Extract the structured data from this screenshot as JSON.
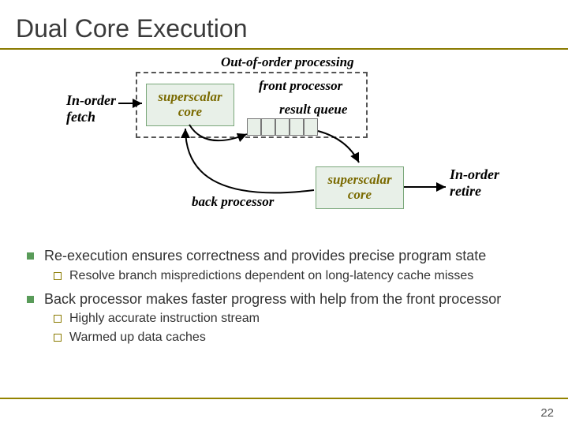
{
  "title": "Dual Core Execution",
  "diagram": {
    "labels": {
      "in_order_fetch_l1": "In-order",
      "in_order_fetch_l2": "fetch",
      "out_of_order": "Out-of-order  processing",
      "front_processor": "front processor",
      "result_queue": "result queue",
      "back_processor": "back processor",
      "in_order_retire_l1": "In-order",
      "in_order_retire_l2": "retire"
    },
    "boxes": {
      "superscalar_core_front": "superscalar\ncore",
      "superscalar_core_back": "superscalar\ncore"
    }
  },
  "bullets": [
    {
      "text": "Re-execution ensures correctness and provides precise program state",
      "sub": [
        "Resolve branch mispredictions dependent on long-latency cache misses"
      ]
    },
    {
      "text": "Back processor makes faster progress with help from the front processor",
      "sub": [
        "Highly accurate instruction stream",
        "Warmed up data caches"
      ]
    }
  ],
  "page_number": "22"
}
